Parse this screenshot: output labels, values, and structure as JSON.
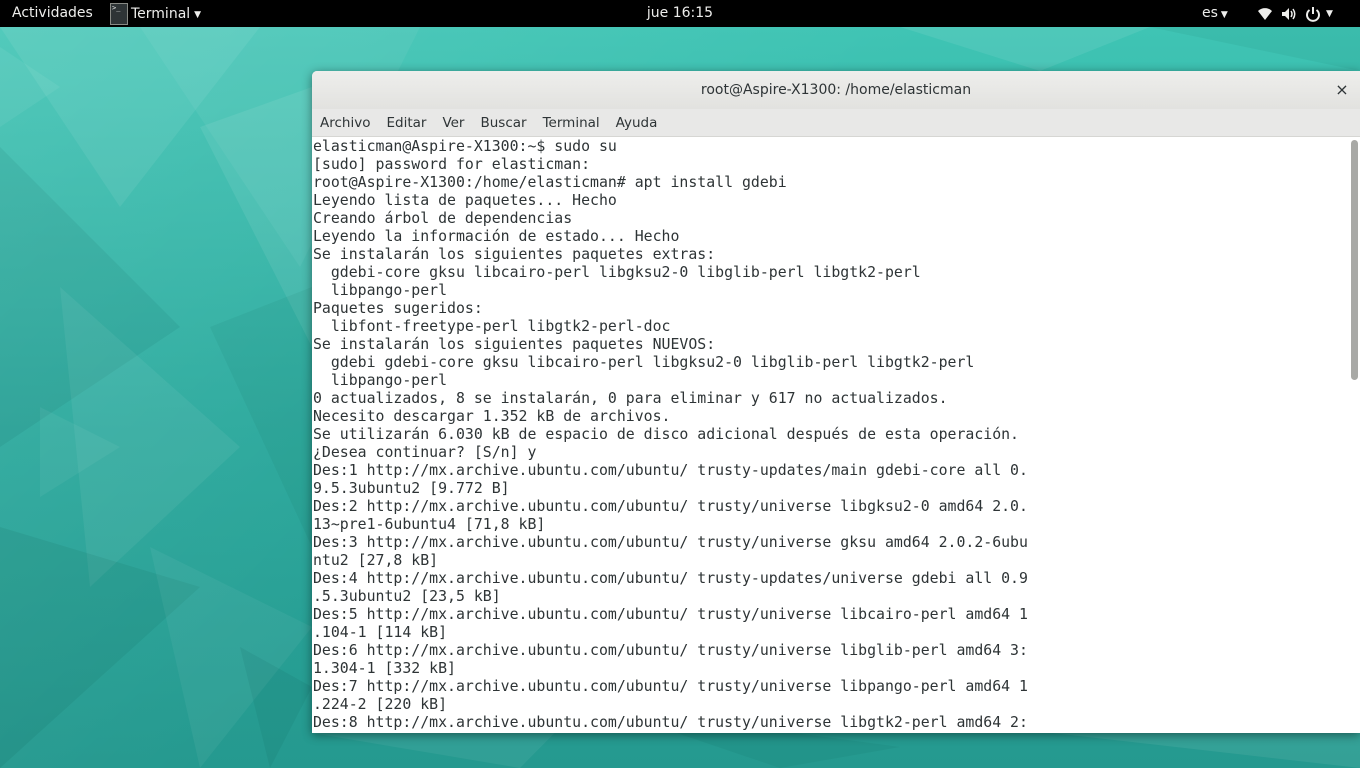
{
  "topbar": {
    "activities": "Actividades",
    "app_name": "Terminal",
    "app_icon_text": ">_",
    "clock": "jue 16:15",
    "language": "es",
    "icons": [
      "network-wireless-icon",
      "volume-icon",
      "power-icon",
      "chevron-down-icon"
    ]
  },
  "window": {
    "title": "root@Aspire-X1300: /home/elasticman",
    "close_glyph": "×"
  },
  "menubar": {
    "items": [
      "Archivo",
      "Editar",
      "Ver",
      "Buscar",
      "Terminal",
      "Ayuda"
    ]
  },
  "terminal": {
    "lines": [
      "elasticman@Aspire-X1300:~$ sudo su",
      "[sudo] password for elasticman:",
      "root@Aspire-X1300:/home/elasticman# apt install gdebi",
      "Leyendo lista de paquetes... Hecho",
      "Creando árbol de dependencias",
      "Leyendo la información de estado... Hecho",
      "Se instalarán los siguientes paquetes extras:",
      "  gdebi-core gksu libcairo-perl libgksu2-0 libglib-perl libgtk2-perl",
      "  libpango-perl",
      "Paquetes sugeridos:",
      "  libfont-freetype-perl libgtk2-perl-doc",
      "Se instalarán los siguientes paquetes NUEVOS:",
      "  gdebi gdebi-core gksu libcairo-perl libgksu2-0 libglib-perl libgtk2-perl",
      "  libpango-perl",
      "0 actualizados, 8 se instalarán, 0 para eliminar y 617 no actualizados.",
      "Necesito descargar 1.352 kB de archivos.",
      "Se utilizarán 6.030 kB de espacio de disco adicional después de esta operación.",
      "¿Desea continuar? [S/n] y",
      "Des:1 http://mx.archive.ubuntu.com/ubuntu/ trusty-updates/main gdebi-core all 0.",
      "9.5.3ubuntu2 [9.772 B]",
      "Des:2 http://mx.archive.ubuntu.com/ubuntu/ trusty/universe libgksu2-0 amd64 2.0.",
      "13~pre1-6ubuntu4 [71,8 kB]",
      "Des:3 http://mx.archive.ubuntu.com/ubuntu/ trusty/universe gksu amd64 2.0.2-6ubu",
      "ntu2 [27,8 kB]",
      "Des:4 http://mx.archive.ubuntu.com/ubuntu/ trusty-updates/universe gdebi all 0.9",
      ".5.3ubuntu2 [23,5 kB]",
      "Des:5 http://mx.archive.ubuntu.com/ubuntu/ trusty/universe libcairo-perl amd64 1",
      ".104-1 [114 kB]",
      "Des:6 http://mx.archive.ubuntu.com/ubuntu/ trusty/universe libglib-perl amd64 3:",
      "1.304-1 [332 kB]",
      "Des:7 http://mx.archive.ubuntu.com/ubuntu/ trusty/universe libpango-perl amd64 1",
      ".224-2 [220 kB]",
      "Des:8 http://mx.archive.ubuntu.com/ubuntu/ trusty/universe libgtk2-perl amd64 2:"
    ]
  },
  "colors": {
    "topbar_bg": "#000000",
    "wallpaper": "#2fa79c",
    "terminal_bg": "#ffffff",
    "terminal_fg": "#2e3436"
  }
}
